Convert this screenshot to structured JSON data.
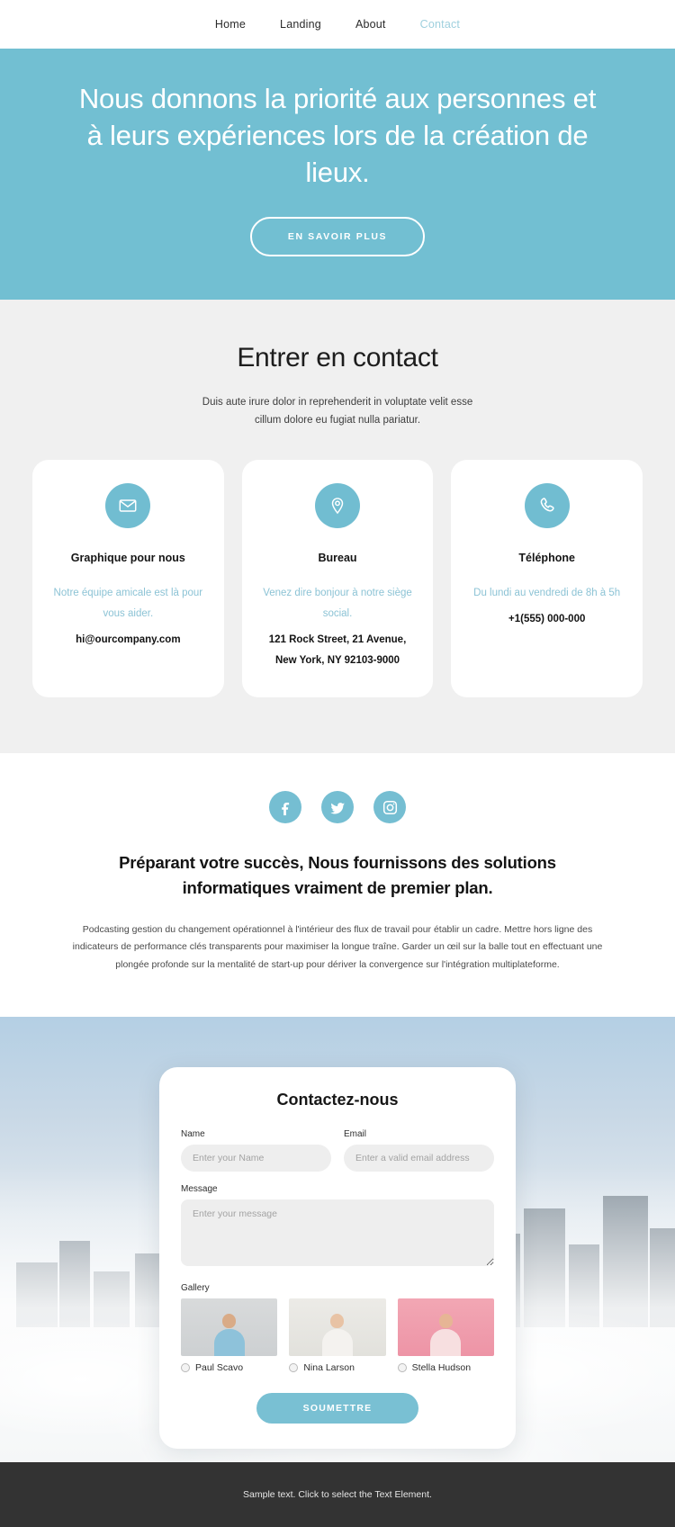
{
  "nav": {
    "items": [
      {
        "label": "Home",
        "active": false
      },
      {
        "label": "Landing",
        "active": false
      },
      {
        "label": "About",
        "active": false
      },
      {
        "label": "Contact",
        "active": true
      }
    ]
  },
  "hero": {
    "title": "Nous donnons la priorité aux personnes et à leurs expériences lors de la création de lieux.",
    "button_label": "EN SAVOIR PLUS",
    "background_color": "#72bfd2"
  },
  "contact": {
    "title": "Entrer en contact",
    "subtitle": "Duis aute irure dolor in reprehenderit in voluptate velit esse cillum dolore eu fugiat nulla pariatur.",
    "cards": [
      {
        "icon": "envelope-icon",
        "title": "Graphique pour nous",
        "note": "Notre équipe amicale est là pour vous aider.",
        "value": "hi@ourcompany.com"
      },
      {
        "icon": "location-pin-icon",
        "title": "Bureau",
        "note": "Venez dire bonjour à notre siège social.",
        "value": "121 Rock Street, 21 Avenue, New York, NY 92103-9000"
      },
      {
        "icon": "phone-icon",
        "title": "Téléphone",
        "note": "Du lundi au vendredi de 8h à 5h",
        "value": "+1(555) 000-000"
      }
    ],
    "accent_color": "#71bdd1",
    "note_color": "#8cc3d5"
  },
  "about": {
    "social": [
      {
        "icon": "facebook-icon",
        "label": "Facebook"
      },
      {
        "icon": "twitter-icon",
        "label": "Twitter"
      },
      {
        "icon": "instagram-icon",
        "label": "Instagram"
      }
    ],
    "title": "Préparant votre succès, Nous fournissons des solutions informatiques vraiment de premier plan.",
    "body": "Podcasting gestion du changement opérationnel à l'intérieur des flux de travail pour établir un cadre. Mettre hors ligne des indicateurs de performance clés transparents pour maximiser la longue traîne. Garder un œil sur la balle tout en effectuant une plongée profonde sur la mentalité de start-up pour dériver la convergence sur l'intégration multiplateforme."
  },
  "form": {
    "title": "Contactez-nous",
    "name_label": "Name",
    "name_placeholder": "Enter your Name",
    "name_value": "",
    "email_label": "Email",
    "email_placeholder": "Enter a valid email address",
    "email_value": "",
    "message_label": "Message",
    "message_placeholder": "Enter your message",
    "message_value": "",
    "gallery_label": "Gallery",
    "gallery": [
      {
        "name": "Paul Scavo",
        "selected": false
      },
      {
        "name": "Nina Larson",
        "selected": false
      },
      {
        "name": "Stella Hudson",
        "selected": false
      }
    ],
    "submit_label": "SOUMETTRE",
    "submit_color": "#79c0d3"
  },
  "footer": {
    "text": "Sample text. Click to select the Text Element.",
    "background_color": "#333333"
  }
}
